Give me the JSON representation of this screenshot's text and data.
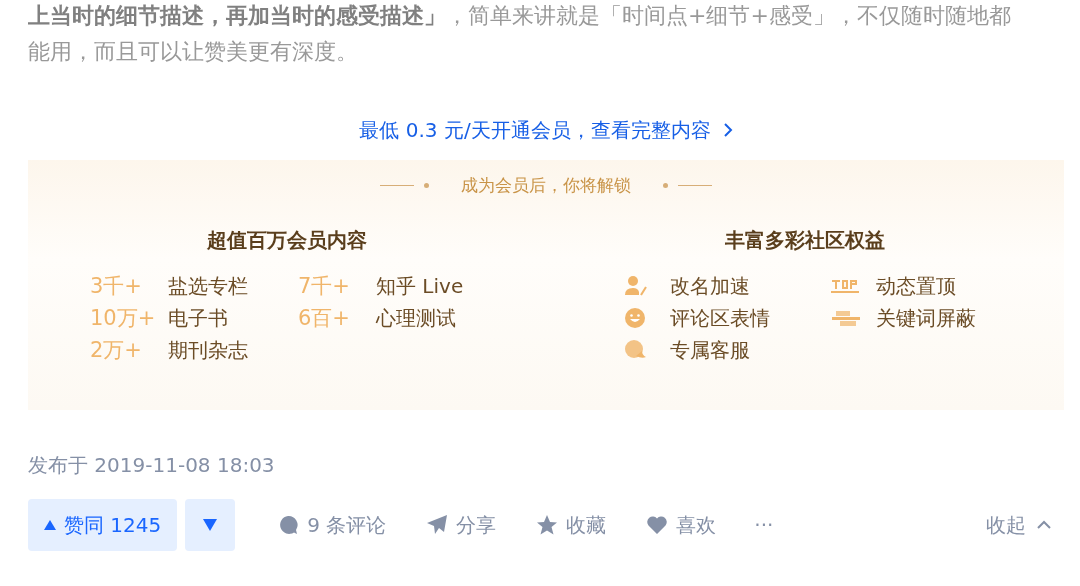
{
  "article": {
    "paragraph": "**上当时的细节描述，再加当时的感受描述」**，简单来讲就是「时间点+细节+感受」，不仅随时随地都能用，而且可以让赞美更有深度。"
  },
  "membership_link": "最低 0.3 元/天开通会员，查看完整内容",
  "unlock_card": {
    "title": "成为会员后，你将解锁",
    "content": {
      "heading": "超值百万会员内容",
      "items": [
        {
          "count": "3千+",
          "label": "盐选专栏"
        },
        {
          "count": "10万+",
          "label": "电子书"
        },
        {
          "count": "2万+",
          "label": "期刊杂志"
        },
        {
          "count": "7千+",
          "label": "知乎 Live"
        },
        {
          "count": "6百+",
          "label": "心理测试"
        }
      ]
    },
    "benefits": {
      "heading": "丰富多彩社区权益",
      "items": [
        {
          "kind": "rename",
          "label": "改名加速"
        },
        {
          "kind": "emoji",
          "label": "评论区表情"
        },
        {
          "kind": "chat",
          "label": "专属客服"
        },
        {
          "kind": "top",
          "label": "动态置顶"
        },
        {
          "kind": "filter",
          "label": "关键词屏蔽"
        }
      ]
    }
  },
  "published": "发布于 2019-11-08 18:03",
  "actions": {
    "upvote": "赞同 1245",
    "items": [
      {
        "kind": "comment",
        "label": "9 条评论"
      },
      {
        "kind": "share",
        "label": "分享"
      },
      {
        "kind": "favorite",
        "label": "收藏"
      },
      {
        "kind": "like",
        "label": "喜欢"
      }
    ],
    "more": "···",
    "collapse": "收起"
  }
}
